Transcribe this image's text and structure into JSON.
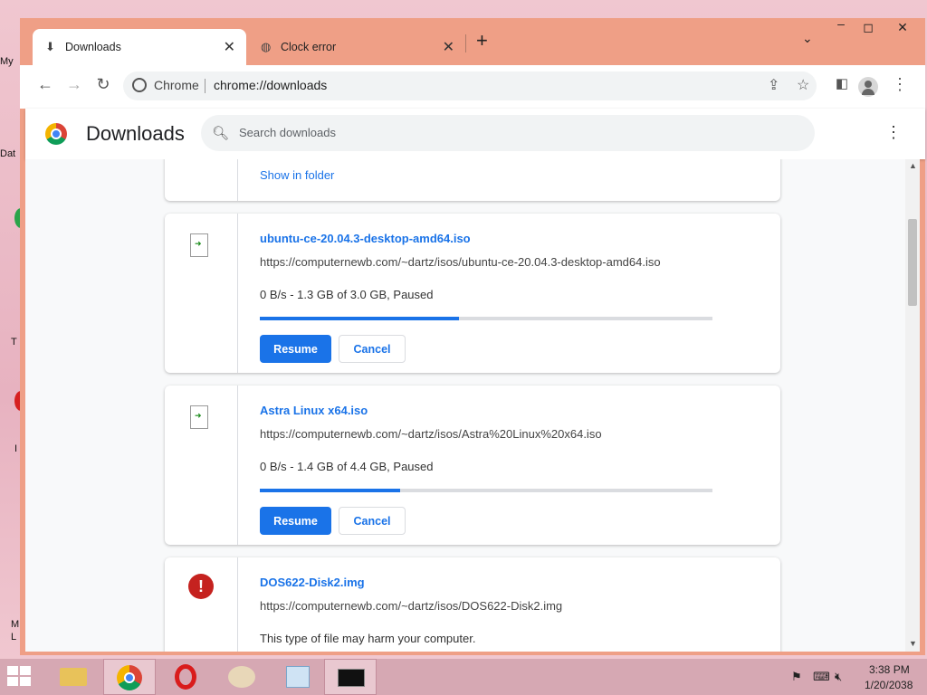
{
  "desktop": {
    "icon_labels": [
      "My",
      "Dat",
      "T",
      "I",
      "M",
      "L"
    ]
  },
  "browser": {
    "tabs": [
      {
        "label": "Downloads",
        "icon": "download-icon",
        "active": true
      },
      {
        "label": "Clock error",
        "icon": "globe-icon",
        "active": false
      }
    ],
    "omnibox": {
      "site_label": "Chrome",
      "url": "chrome://downloads"
    }
  },
  "downloads_page": {
    "title": "Downloads",
    "search_placeholder": "Search downloads",
    "top_partial_link": "Show in folder",
    "items": [
      {
        "filename": "ubuntu-ce-20.04.3-desktop-amd64.iso",
        "url": "https://computernewb.com/~dartz/isos/ubuntu-ce-20.04.3-desktop-amd64.iso",
        "status": "0 B/s - 1.3 GB of 3.0 GB, Paused",
        "progress": 0.44,
        "primary_button": "Resume",
        "secondary_button": "Cancel"
      },
      {
        "filename": "Astra Linux x64.iso",
        "url": "https://computernewb.com/~dartz/isos/Astra%20Linux%20x64.iso",
        "status": "0 B/s - 1.4 GB of 4.4 GB, Paused",
        "progress": 0.31,
        "primary_button": "Resume",
        "secondary_button": "Cancel"
      },
      {
        "filename": "DOS622-Disk2.img",
        "url": "https://computernewb.com/~dartz/isos/DOS622-Disk2.img",
        "status": "This type of file may harm your computer."
      }
    ]
  },
  "taskbar": {
    "apps": [
      "file-explorer-icon",
      "chrome-icon",
      "opera-icon",
      "paint-icon",
      "calendar-icon",
      "command-prompt-icon"
    ],
    "clock_time": "3:38 PM",
    "clock_date": "1/20/2038"
  },
  "colors": {
    "accent": "#1a73e8",
    "window_frame": "#ef9f86",
    "error": "#c5221f"
  }
}
